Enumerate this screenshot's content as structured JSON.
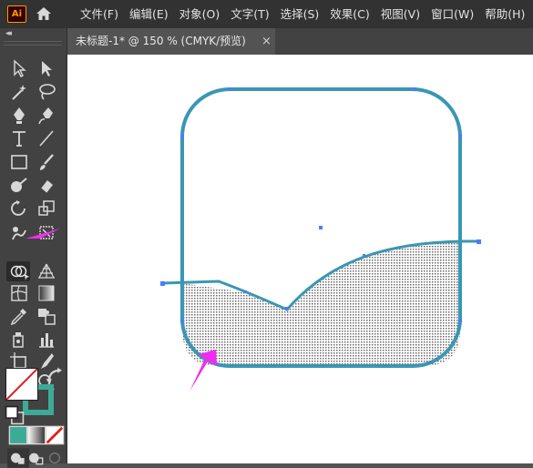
{
  "app": {
    "logo_text": "Ai"
  },
  "menu": {
    "items": [
      "文件(F)",
      "编辑(E)",
      "对象(O)",
      "文字(T)",
      "选择(S)",
      "效果(C)",
      "视图(V)",
      "窗口(W)",
      "帮助(H)"
    ]
  },
  "tab": {
    "title": "未标题-1* @ 150 % (CMYK/预览)",
    "close": "×"
  },
  "toolbar": {
    "collapse": "◂◂",
    "tools": [
      "selection-tool",
      "direct-selection-tool",
      "magic-wand-tool",
      "lasso-tool",
      "pen-tool",
      "curvature-tool",
      "type-tool",
      "line-segment-tool",
      "rectangle-tool",
      "paintbrush-tool",
      "blob-brush-tool",
      "eraser-tool",
      "rotate-tool",
      "scale-tool",
      "puppet-warp-tool",
      "free-transform-tool",
      "shape-builder-tool",
      "perspective-grid-tool",
      "mesh-tool",
      "gradient-tool",
      "eyedropper-tool",
      "blend-tool",
      "symbol-sprayer-tool",
      "column-graph-tool",
      "artboard-tool",
      "slice-tool",
      "hand-tool",
      "zoom-tool"
    ]
  },
  "colors": {
    "stroke": "#3daa96",
    "path_stroke": "#3a96b4",
    "annotation_arrow": "#f02cf0",
    "anchor": "#4a7cff"
  }
}
